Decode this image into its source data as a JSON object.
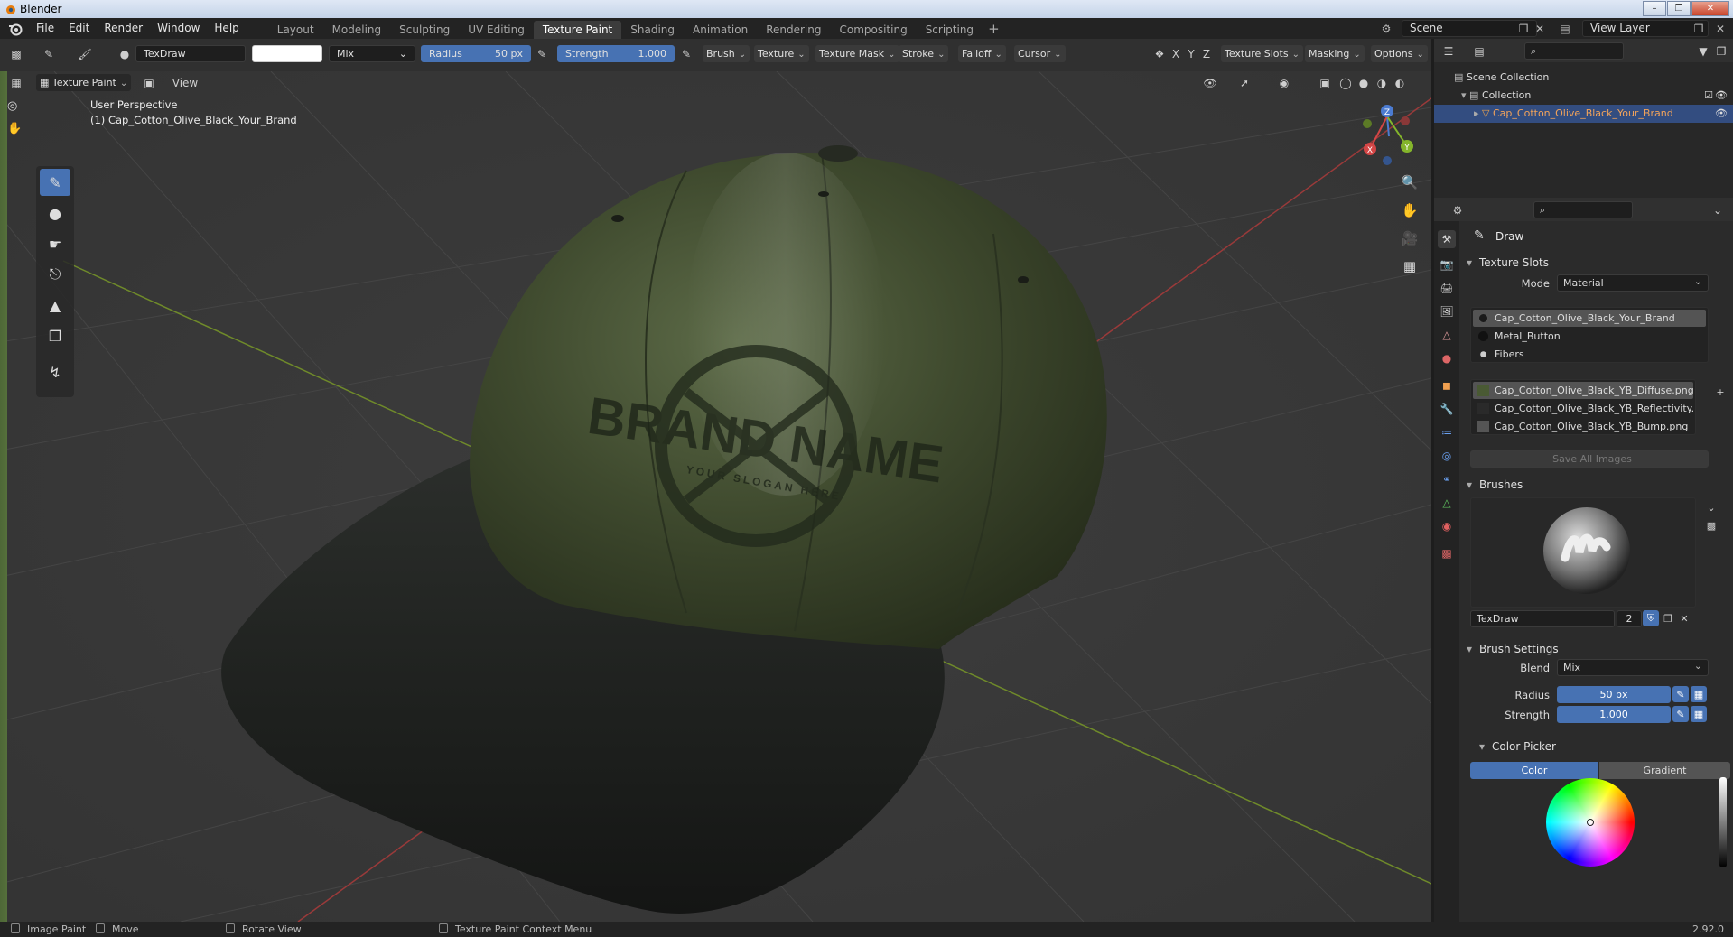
{
  "window": {
    "title": "Blender"
  },
  "menu": [
    "File",
    "Edit",
    "Render",
    "Window",
    "Help"
  ],
  "workspaces": [
    "Layout",
    "Modeling",
    "Sculpting",
    "UV Editing",
    "Texture Paint",
    "Shading",
    "Animation",
    "Rendering",
    "Compositing",
    "Scripting"
  ],
  "active_workspace": "Texture Paint",
  "scene": {
    "name": "Scene",
    "view_layer": "View Layer"
  },
  "tool_header": {
    "brush_name": "TexDraw",
    "blend": "Mix",
    "radius_label": "Radius",
    "radius_value": "50 px",
    "strength_label": "Strength",
    "strength_value": "1.000",
    "dropdowns": [
      "Brush",
      "Texture",
      "Texture Mask",
      "Stroke",
      "Falloff",
      "Cursor"
    ],
    "axes": [
      "X",
      "Y",
      "Z"
    ],
    "right_dropdowns": [
      "Texture Slots",
      "Masking",
      "Options"
    ]
  },
  "viewport_header": {
    "mode": "Texture Paint",
    "view_menu": "View"
  },
  "viewport": {
    "perspective": "User Perspective",
    "object_label": "(1) Cap_Cotton_Olive_Black_Your_Brand",
    "brand_text": "BRAND NAME",
    "slogan_text": "YOUR SLOGAN HERE",
    "gizmo": {
      "x": "X",
      "y": "Y",
      "z": "Z"
    }
  },
  "outliner": {
    "scene_collection": "Scene Collection",
    "collection": "Collection",
    "object": "Cap_Cotton_Olive_Black_Your_Brand"
  },
  "properties": {
    "tool_name": "Draw",
    "texture_slots": {
      "title": "Texture Slots",
      "mode_label": "Mode",
      "mode_value": "Material",
      "materials": [
        "Cap_Cotton_Olive_Black_Your_Brand",
        "Metal_Button",
        "Fibers"
      ],
      "images": [
        "Cap_Cotton_Olive_Black_YB_Diffuse.png",
        "Cap_Cotton_Olive_Black_YB_Reflectivity.p...",
        "Cap_Cotton_Olive_Black_YB_Bump.png"
      ],
      "save_button": "Save All Images"
    },
    "brushes": {
      "title": "Brushes",
      "brush_name": "TexDraw",
      "users": "2"
    },
    "brush_settings": {
      "title": "Brush Settings",
      "blend_label": "Blend",
      "blend_value": "Mix",
      "radius_label": "Radius",
      "radius_value": "50 px",
      "strength_label": "Strength",
      "strength_value": "1.000"
    },
    "color_picker": {
      "title": "Color Picker",
      "tab_color": "Color",
      "tab_gradient": "Gradient"
    }
  },
  "statusbar": {
    "items": [
      "Image Paint",
      "Move",
      "Rotate View",
      "Texture Paint Context Menu"
    ],
    "version": "2.92.0"
  },
  "colors": {
    "accent": "#4772b3",
    "cap_olive": "#3f4a2e",
    "cap_bill": "#1c1e1c",
    "selected_row": "#334d80"
  }
}
